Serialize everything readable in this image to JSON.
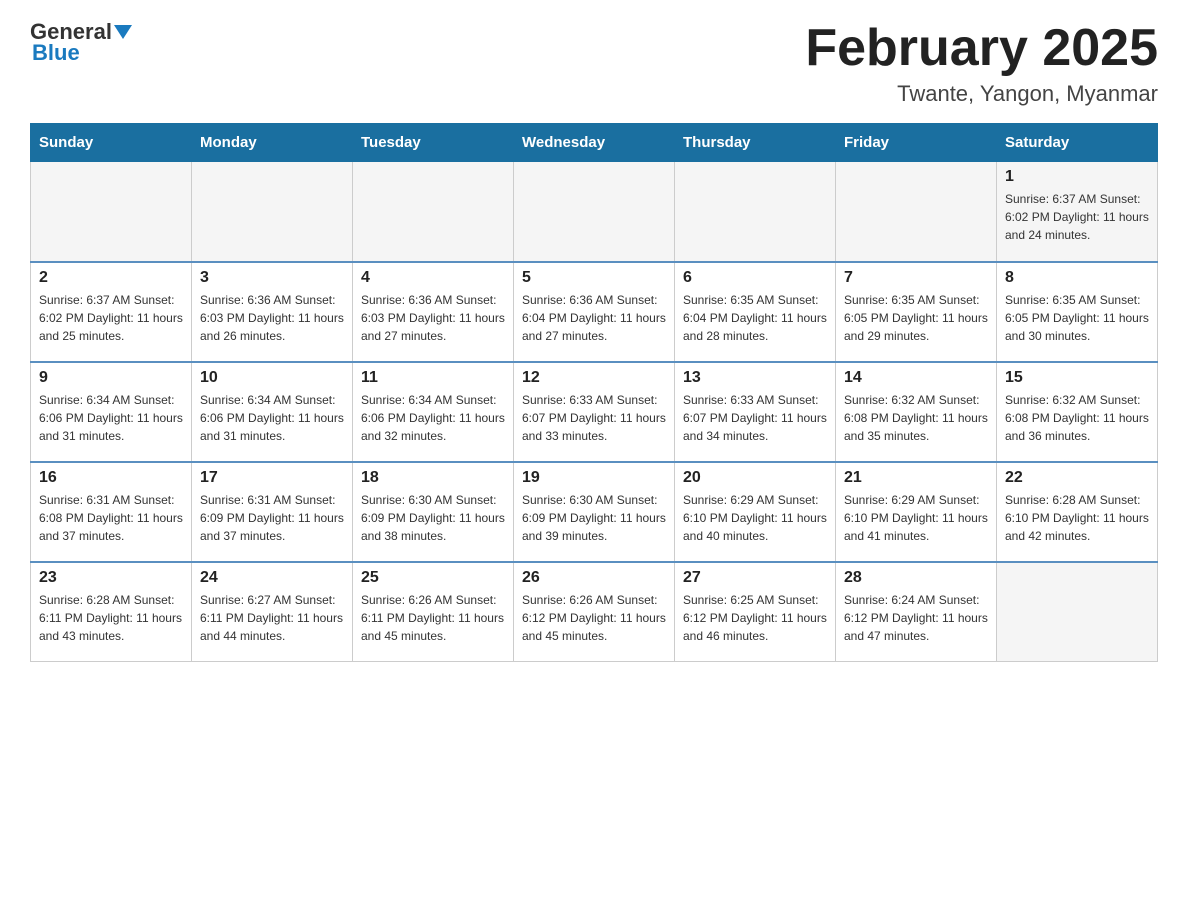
{
  "header": {
    "logo_line1": "General",
    "logo_line2": "Blue",
    "title": "February 2025",
    "subtitle": "Twante, Yangon, Myanmar"
  },
  "days_of_week": [
    "Sunday",
    "Monday",
    "Tuesday",
    "Wednesday",
    "Thursday",
    "Friday",
    "Saturday"
  ],
  "weeks": [
    [
      {
        "day": "",
        "info": ""
      },
      {
        "day": "",
        "info": ""
      },
      {
        "day": "",
        "info": ""
      },
      {
        "day": "",
        "info": ""
      },
      {
        "day": "",
        "info": ""
      },
      {
        "day": "",
        "info": ""
      },
      {
        "day": "1",
        "info": "Sunrise: 6:37 AM\nSunset: 6:02 PM\nDaylight: 11 hours\nand 24 minutes."
      }
    ],
    [
      {
        "day": "2",
        "info": "Sunrise: 6:37 AM\nSunset: 6:02 PM\nDaylight: 11 hours\nand 25 minutes."
      },
      {
        "day": "3",
        "info": "Sunrise: 6:36 AM\nSunset: 6:03 PM\nDaylight: 11 hours\nand 26 minutes."
      },
      {
        "day": "4",
        "info": "Sunrise: 6:36 AM\nSunset: 6:03 PM\nDaylight: 11 hours\nand 27 minutes."
      },
      {
        "day": "5",
        "info": "Sunrise: 6:36 AM\nSunset: 6:04 PM\nDaylight: 11 hours\nand 27 minutes."
      },
      {
        "day": "6",
        "info": "Sunrise: 6:35 AM\nSunset: 6:04 PM\nDaylight: 11 hours\nand 28 minutes."
      },
      {
        "day": "7",
        "info": "Sunrise: 6:35 AM\nSunset: 6:05 PM\nDaylight: 11 hours\nand 29 minutes."
      },
      {
        "day": "8",
        "info": "Sunrise: 6:35 AM\nSunset: 6:05 PM\nDaylight: 11 hours\nand 30 minutes."
      }
    ],
    [
      {
        "day": "9",
        "info": "Sunrise: 6:34 AM\nSunset: 6:06 PM\nDaylight: 11 hours\nand 31 minutes."
      },
      {
        "day": "10",
        "info": "Sunrise: 6:34 AM\nSunset: 6:06 PM\nDaylight: 11 hours\nand 31 minutes."
      },
      {
        "day": "11",
        "info": "Sunrise: 6:34 AM\nSunset: 6:06 PM\nDaylight: 11 hours\nand 32 minutes."
      },
      {
        "day": "12",
        "info": "Sunrise: 6:33 AM\nSunset: 6:07 PM\nDaylight: 11 hours\nand 33 minutes."
      },
      {
        "day": "13",
        "info": "Sunrise: 6:33 AM\nSunset: 6:07 PM\nDaylight: 11 hours\nand 34 minutes."
      },
      {
        "day": "14",
        "info": "Sunrise: 6:32 AM\nSunset: 6:08 PM\nDaylight: 11 hours\nand 35 minutes."
      },
      {
        "day": "15",
        "info": "Sunrise: 6:32 AM\nSunset: 6:08 PM\nDaylight: 11 hours\nand 36 minutes."
      }
    ],
    [
      {
        "day": "16",
        "info": "Sunrise: 6:31 AM\nSunset: 6:08 PM\nDaylight: 11 hours\nand 37 minutes."
      },
      {
        "day": "17",
        "info": "Sunrise: 6:31 AM\nSunset: 6:09 PM\nDaylight: 11 hours\nand 37 minutes."
      },
      {
        "day": "18",
        "info": "Sunrise: 6:30 AM\nSunset: 6:09 PM\nDaylight: 11 hours\nand 38 minutes."
      },
      {
        "day": "19",
        "info": "Sunrise: 6:30 AM\nSunset: 6:09 PM\nDaylight: 11 hours\nand 39 minutes."
      },
      {
        "day": "20",
        "info": "Sunrise: 6:29 AM\nSunset: 6:10 PM\nDaylight: 11 hours\nand 40 minutes."
      },
      {
        "day": "21",
        "info": "Sunrise: 6:29 AM\nSunset: 6:10 PM\nDaylight: 11 hours\nand 41 minutes."
      },
      {
        "day": "22",
        "info": "Sunrise: 6:28 AM\nSunset: 6:10 PM\nDaylight: 11 hours\nand 42 minutes."
      }
    ],
    [
      {
        "day": "23",
        "info": "Sunrise: 6:28 AM\nSunset: 6:11 PM\nDaylight: 11 hours\nand 43 minutes."
      },
      {
        "day": "24",
        "info": "Sunrise: 6:27 AM\nSunset: 6:11 PM\nDaylight: 11 hours\nand 44 minutes."
      },
      {
        "day": "25",
        "info": "Sunrise: 6:26 AM\nSunset: 6:11 PM\nDaylight: 11 hours\nand 45 minutes."
      },
      {
        "day": "26",
        "info": "Sunrise: 6:26 AM\nSunset: 6:12 PM\nDaylight: 11 hours\nand 45 minutes."
      },
      {
        "day": "27",
        "info": "Sunrise: 6:25 AM\nSunset: 6:12 PM\nDaylight: 11 hours\nand 46 minutes."
      },
      {
        "day": "28",
        "info": "Sunrise: 6:24 AM\nSunset: 6:12 PM\nDaylight: 11 hours\nand 47 minutes."
      },
      {
        "day": "",
        "info": ""
      }
    ]
  ]
}
